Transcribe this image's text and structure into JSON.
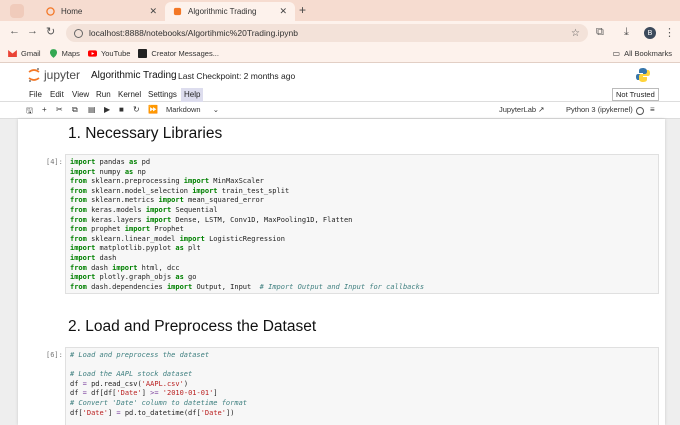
{
  "browser": {
    "tabs": [
      {
        "title": "Home",
        "active": false
      },
      {
        "title": "Algorithmic Trading",
        "active": true
      }
    ],
    "url": "localhost:8888/notebooks/Algortihmic%20Trading.ipynb",
    "avatar_letter": "B",
    "bookmarks": [
      "Gmail",
      "Maps",
      "YouTube",
      "Creator Messages..."
    ],
    "all_bookmarks": "All Bookmarks"
  },
  "jupyter": {
    "logo_text": "jupyter",
    "notebook_name": "Algorithmic Trading",
    "checkpoint": "Last Checkpoint: 2 months ago",
    "menus": [
      "File",
      "Edit",
      "View",
      "Run",
      "Kernel",
      "Settings",
      "Help"
    ],
    "active_menu": "Help",
    "trust": "Not Trusted",
    "cell_type": "Markdown",
    "jupyterlab": "JupyterLab",
    "kernel": "Python 3 (ipykernel)"
  },
  "cells": {
    "h1": "1. Necessary Libraries",
    "prompt1": "[4]:",
    "h2": "2. Load and Preprocess the Dataset",
    "prompt2": "[6]:"
  },
  "colors": {
    "tab_strip": "#f6dcd0",
    "toolbar": "#fdf2ec",
    "keyword": "#008000",
    "comment": "#408080",
    "string": "#ba2121",
    "jupyter_orange": "#f37726"
  }
}
